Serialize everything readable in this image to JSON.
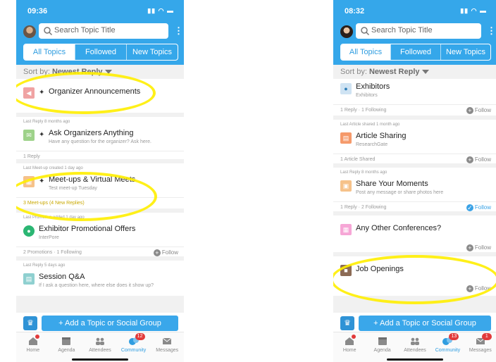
{
  "left": {
    "status_time": "09:36",
    "search_placeholder": "Search Topic Title",
    "tabs": [
      "All Topics",
      "Followed",
      "New Topics"
    ],
    "sort_prefix": "Sort by:",
    "sort_value": "Newest Reply",
    "topics": [
      {
        "meta": "",
        "title": "Organizer Announcements",
        "sub": "",
        "stats": "",
        "pinned": true,
        "icon_color": "#f0a3a3",
        "icon": "megaphone-icon"
      },
      {
        "meta": "Last Reply 8 months ago",
        "title": "Ask Organizers Anything",
        "sub": "Have any question for the organizer? Ask here.",
        "stats": "1 Reply",
        "pinned": true,
        "icon_color": "#9ed28a",
        "icon": "chat-icon"
      },
      {
        "meta": "Last Meet-up created 1 day ago",
        "title": "Meet-ups & Virtual Meets",
        "sub": "Test meet-up Tuesday",
        "stats": "3 Meet-ups (4 New Replies)",
        "pinned": true,
        "icon_color": "#f6c28a",
        "icon": "calendar-icon"
      },
      {
        "meta": "Last Promotion added 1 day ago",
        "title": "Exhibitor Promotional Offers",
        "sub": "InterPore",
        "stats": "2 Promotions · 1 Following",
        "follow": "Follow",
        "icon_color": "#2bb673",
        "icon": "tag-icon"
      },
      {
        "meta": "Last Reply 5 days ago",
        "title": "Session Q&A",
        "sub": "If I ask a question here, where else does it show up?",
        "stats": "",
        "icon_color": "#8fd0d0",
        "icon": "qa-icon"
      }
    ],
    "add_label": "+ Add a Topic or Social Group",
    "nav": [
      {
        "label": "Home"
      },
      {
        "label": "Agenda"
      },
      {
        "label": "Attendees"
      },
      {
        "label": "Community",
        "badge": "12"
      },
      {
        "label": "Messages"
      }
    ]
  },
  "right": {
    "status_time": "08:32",
    "search_placeholder": "Search Topic Title",
    "tabs": [
      "All Topics",
      "Followed",
      "New Topics"
    ],
    "sort_prefix": "Sort by:",
    "sort_value": "Newest Reply",
    "topics": [
      {
        "meta": "",
        "title": "Exhibitors",
        "sub": "Exhibitors",
        "stats": "1 Reply · 1 Following",
        "follow": "Follow",
        "icon_color": "#cfe3f3",
        "icon": "people-icon"
      },
      {
        "meta": "Last Article shared 1 month ago",
        "title": "Article Sharing",
        "sub": "ResearchGate",
        "stats": "1 Article Shared",
        "follow": "Follow",
        "icon_color": "#f59a6b",
        "icon": "document-icon"
      },
      {
        "meta": "Last Reply 8 months ago",
        "title": "Share Your Moments",
        "sub": "Post any message or share photos here",
        "stats": "1 Reply · 2 Following",
        "follow": "Follow",
        "follow_on": true,
        "icon_color": "#f6c28a",
        "icon": "photo-icon"
      },
      {
        "meta": "",
        "title": "Any Other Conferences?",
        "sub": "",
        "stats": "",
        "follow": "Follow",
        "icon_color": "#f6a6d6",
        "icon": "cart-icon"
      },
      {
        "meta": "",
        "title": "Job Openings",
        "sub": "",
        "stats": "",
        "follow": "Follow",
        "icon_color": "#8c6b55",
        "icon": "briefcase-icon"
      }
    ],
    "add_label": "+ Add a Topic or Social Group",
    "nav": [
      {
        "label": "Home"
      },
      {
        "label": "Agenda"
      },
      {
        "label": "Attendees"
      },
      {
        "label": "Community",
        "badge": "13"
      },
      {
        "label": "Messages",
        "badge": "1"
      }
    ]
  },
  "colors": {
    "accent": "#35a7ea",
    "highlight": "#ffee00",
    "badge": "#e23a3a"
  }
}
